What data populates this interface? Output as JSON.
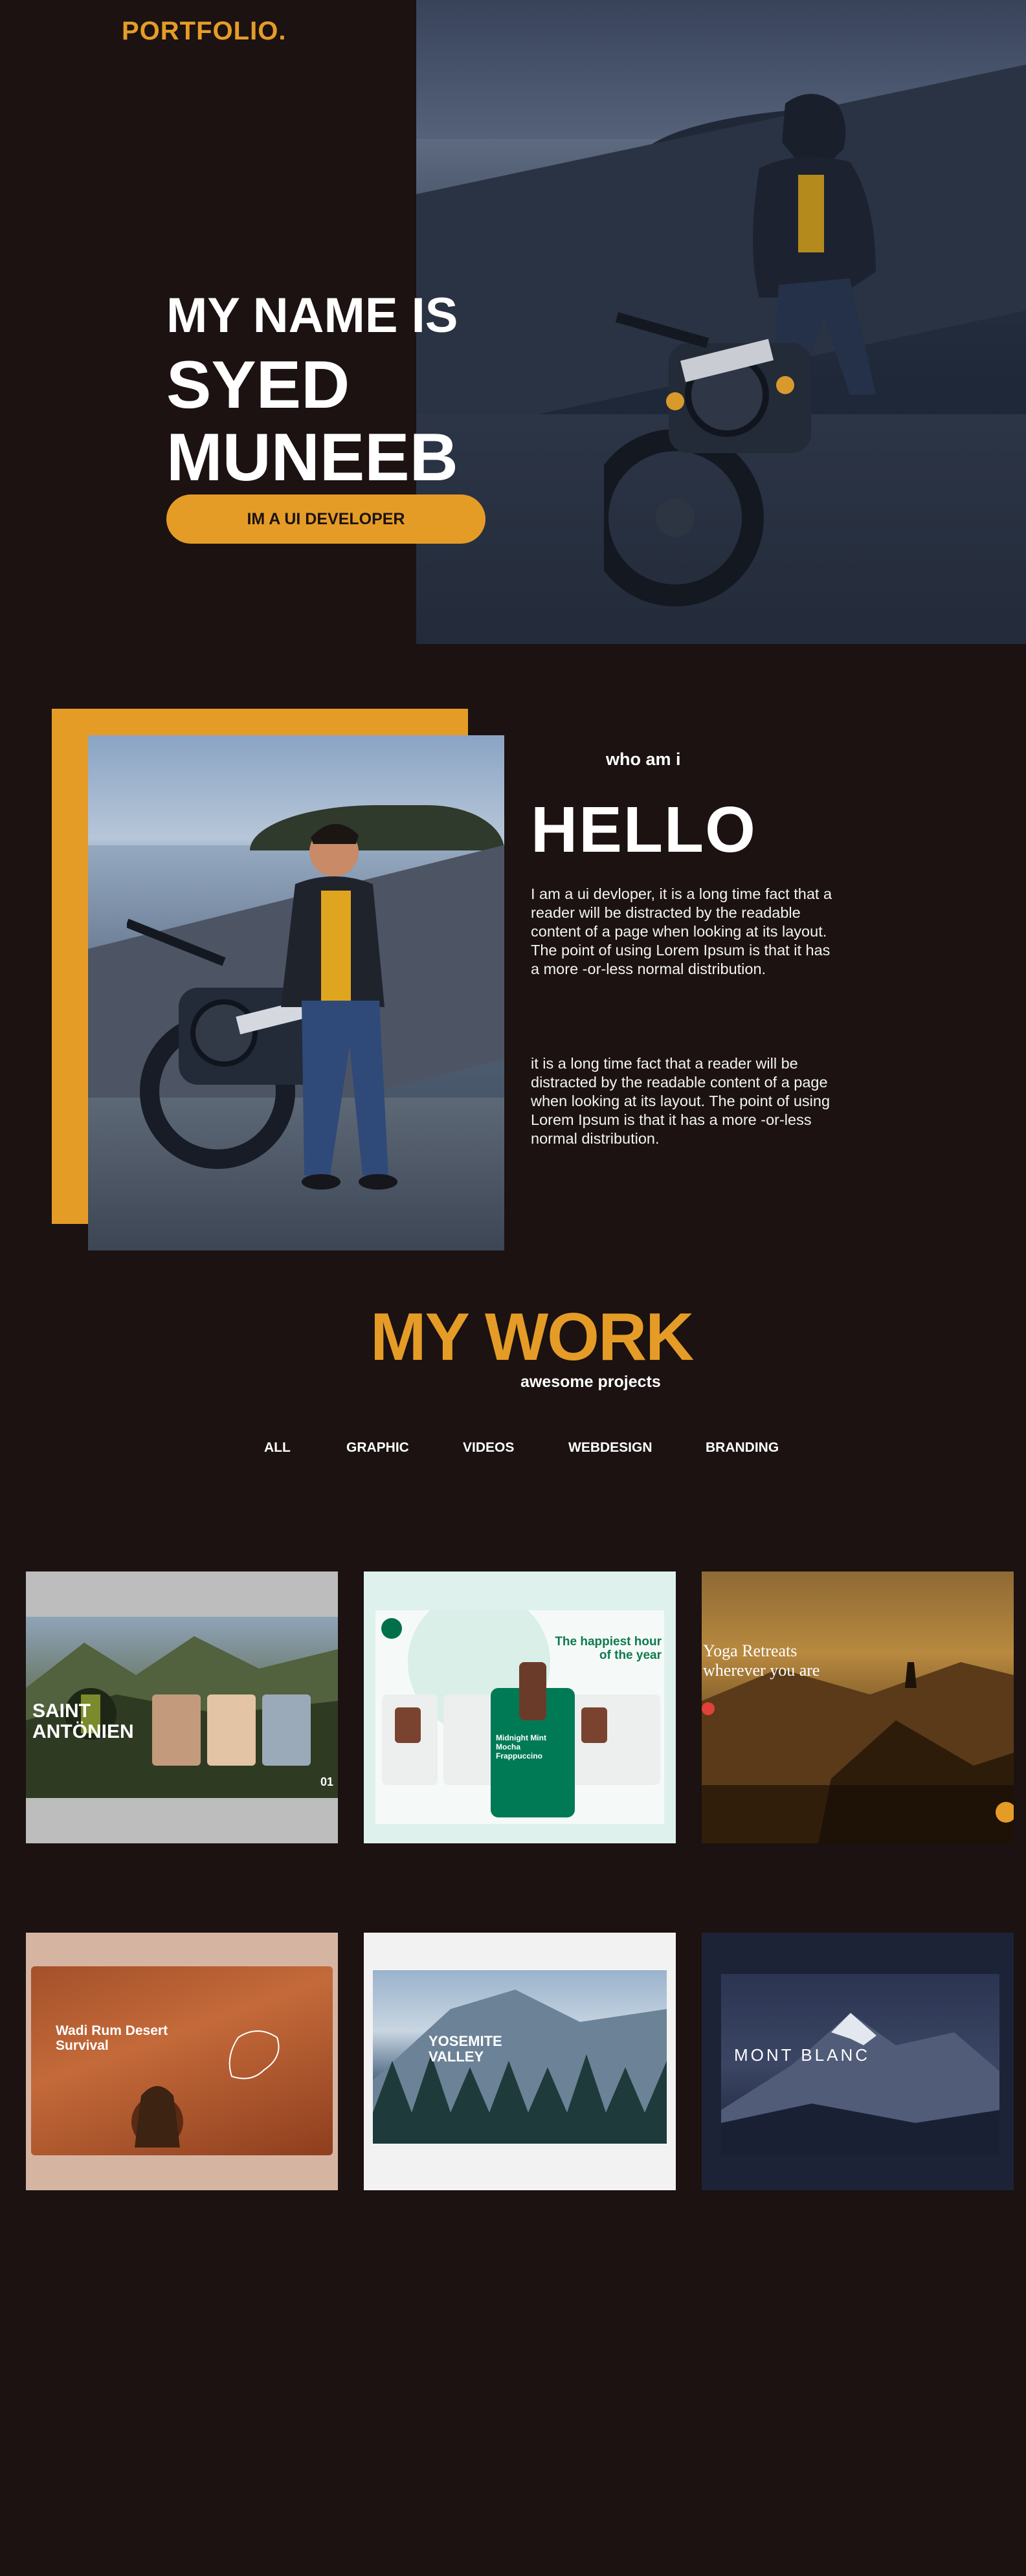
{
  "brand": {
    "logo": "PORTFOLIO."
  },
  "hero": {
    "line1": "MY NAME IS",
    "line2": "SYED",
    "line3": "MUNEEB",
    "cta": "IM A UI DEVELOPER"
  },
  "about": {
    "kicker": "who am i",
    "title": "HELLO",
    "paragraph1": "I am a ui devloper, it is a long time fact that a reader will be distracted by the readable content of a page when looking at its layout. The point of using Lorem Ipsum is that it has a more -or-less normal distribution.",
    "paragraph2": "it is a long time fact that a reader will be distracted by the readable content of a page when looking at its layout. The point of using Lorem Ipsum is that it has a more -or-less normal distribution."
  },
  "work": {
    "title": "MY WORK",
    "subtitle": "awesome projects",
    "filters": [
      "ALL",
      "GRAPHIC",
      "VIDEOS",
      "WEBDESIGN",
      "BRANDING"
    ],
    "projects": [
      {
        "title": "SAINT ANTÖNIEN",
        "index": "01"
      },
      {
        "title": "The happiest hour of the year",
        "product": "Midnight Mint Mocha Frappuccino"
      },
      {
        "title": "Yoga Retreats wherever you are"
      },
      {
        "title": "Wadi Rum Desert Survival"
      },
      {
        "title": "YOSEMITE VALLEY"
      },
      {
        "title": "MONT BLANC"
      }
    ]
  },
  "colors": {
    "accent": "#e59c27",
    "background": "#1b1211",
    "text": "#ffffff"
  }
}
